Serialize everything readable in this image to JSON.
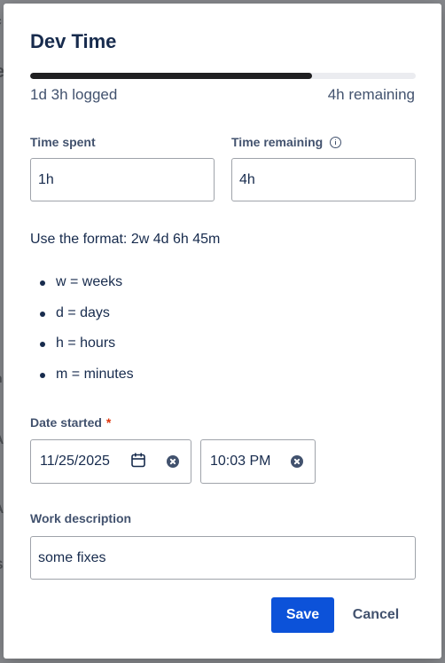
{
  "dialog": {
    "title": "Dev Time",
    "progress": {
      "fraction": 0.73,
      "logged": "1d 3h logged",
      "remaining": "4h remaining",
      "fill_color": "#1f1f21"
    },
    "time_spent": {
      "label": "Time spent",
      "value": "1h"
    },
    "time_remaining": {
      "label": "Time remaining",
      "value": "4h",
      "icon": "info-icon"
    },
    "help_text": "Use the format: 2w 4d 6h 45m",
    "units": [
      "w = weeks",
      "d = days",
      "h = hours",
      "m = minutes"
    ],
    "date_started": {
      "label": "Date started",
      "required_mark": "*",
      "date_value": "11/25/2025",
      "time_value": "10:03 PM",
      "date_icon": "calendar-icon",
      "clear_icon": "clear-icon"
    },
    "work_description": {
      "label": "Work description",
      "value": "some fixes"
    },
    "actions": {
      "save_label": "Save",
      "cancel_label": "Cancel"
    },
    "colors": {
      "primary": "#0c52d9",
      "required": "#de350b",
      "text": "#172b4d",
      "subtle": "#42526e"
    }
  }
}
